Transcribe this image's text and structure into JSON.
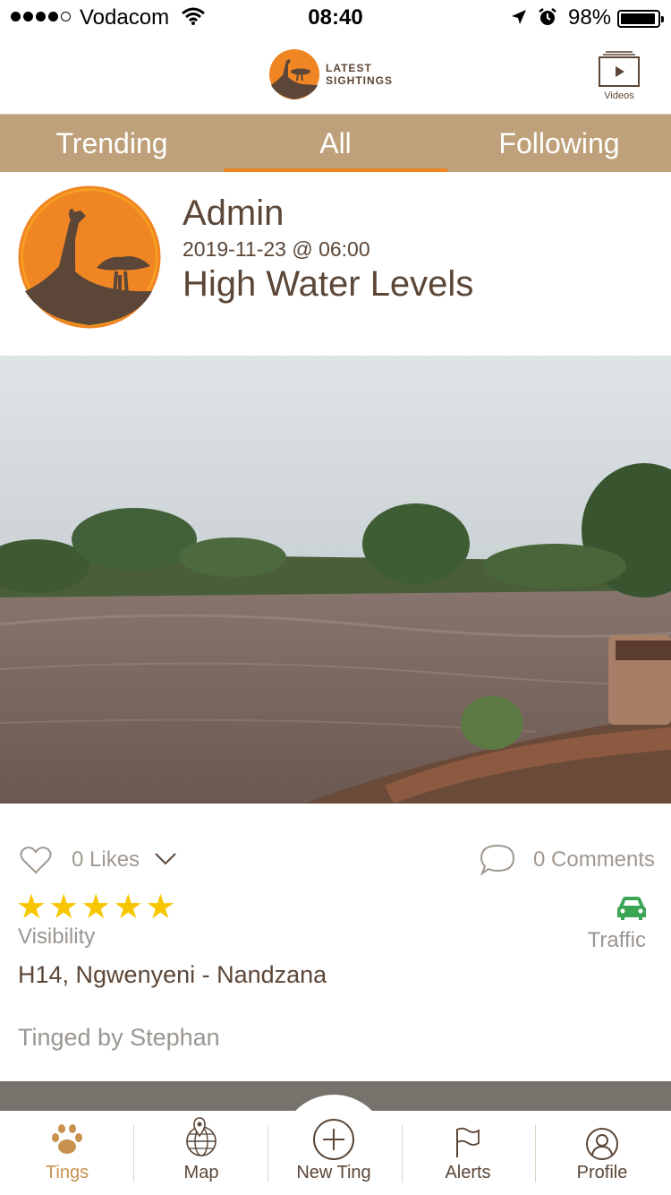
{
  "status_bar": {
    "carrier": "Vodacom",
    "time": "08:40",
    "battery": "98%"
  },
  "header": {
    "logo_line1": "LATEST",
    "logo_line2": "SIGHTINGS",
    "videos_label": "Videos"
  },
  "tabs": [
    {
      "label": "Trending",
      "active": false
    },
    {
      "label": "All",
      "active": true
    },
    {
      "label": "Following",
      "active": false
    }
  ],
  "post": {
    "author": "Admin",
    "date": "2019-11-23 @ 06:00",
    "title": "High Water Levels",
    "likes": "0 Likes",
    "comments": "0 Comments",
    "rating": 5,
    "rating_label": "Visibility",
    "category": "Traffic",
    "location": "H14, Ngwenyeni - Nandzana",
    "tinged_by": "Tinged by Stephan"
  },
  "bottom_nav": [
    {
      "label": "Tings",
      "icon": "paw-icon",
      "active": true
    },
    {
      "label": "Map",
      "icon": "globe-pin-icon",
      "active": false
    },
    {
      "label": "New Ting",
      "icon": "plus-circle-icon",
      "active": false
    },
    {
      "label": "Alerts",
      "icon": "flag-icon",
      "active": false
    },
    {
      "label": "Profile",
      "icon": "user-circle-icon",
      "active": false
    }
  ],
  "colors": {
    "brand_orange": "#f08524",
    "brand_brown": "#5b4637",
    "tab_bar": "#bea17a",
    "star": "#f7c600",
    "traffic_green": "#3aa655"
  }
}
